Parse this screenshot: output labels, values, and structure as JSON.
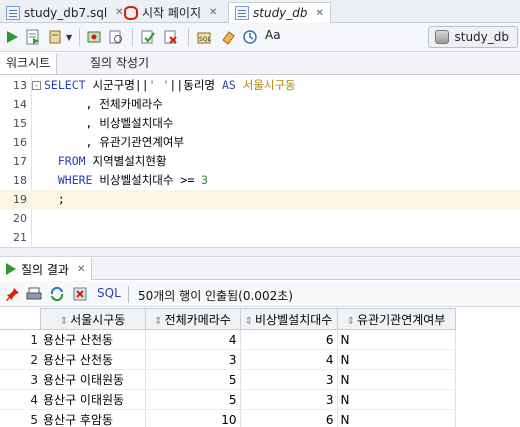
{
  "tabs": [
    {
      "label": "study_db7.sql",
      "icon": "sql-file-icon",
      "active": false
    },
    {
      "label": "시작 페이지",
      "icon": "oracle-logo-icon",
      "active": false
    },
    {
      "label": "study_db",
      "icon": "sql-worksheet-icon",
      "active": true
    }
  ],
  "toolbar": {
    "connection_label": "study_db"
  },
  "subtabs": {
    "worksheet": "워크시트",
    "query_builder": "질의 작성기"
  },
  "editor": {
    "lines": [
      {
        "n": "13",
        "fold": "-",
        "segs": [
          [
            "kw",
            "SELECT "
          ],
          [
            "",
            "시군구명||"
          ],
          [
            "str",
            "' '"
          ],
          [
            "",
            "||동리명 "
          ],
          [
            "kw",
            "AS "
          ],
          [
            "alias",
            "서울시구동"
          ]
        ]
      },
      {
        "n": "14",
        "segs": [
          [
            "",
            "      , 전체카메라수"
          ]
        ]
      },
      {
        "n": "15",
        "segs": [
          [
            "",
            "      , 비상벨설치대수"
          ]
        ]
      },
      {
        "n": "16",
        "segs": [
          [
            "",
            "      , 유관기관연계여부"
          ]
        ]
      },
      {
        "n": "17",
        "segs": [
          [
            "",
            "  "
          ],
          [
            "kw",
            "FROM "
          ],
          [
            "",
            "지역별설치현황"
          ]
        ]
      },
      {
        "n": "18",
        "segs": [
          [
            "",
            "  "
          ],
          [
            "kw",
            "WHERE "
          ],
          [
            "",
            "비상벨설치대수 >= "
          ],
          [
            "num3",
            "3"
          ]
        ]
      },
      {
        "n": "19",
        "segs": [
          [
            "",
            "  ;"
          ]
        ],
        "highlight": true
      },
      {
        "n": "20",
        "segs": []
      },
      {
        "n": "21",
        "segs": []
      }
    ]
  },
  "results": {
    "tab_label": "질의 결과",
    "sql_label": "SQL",
    "message": "50개의 행이 인출됨(0.002초)",
    "columns": [
      "서울시구동",
      "전체카메라수",
      "비상벨설치대수",
      "유관기관연계여부"
    ],
    "rows": [
      {
        "rn": "1",
        "c1": "용산구 산천동",
        "c2": "4",
        "c3": "6",
        "c4": "N"
      },
      {
        "rn": "2",
        "c1": "용산구 산천동",
        "c2": "3",
        "c3": "4",
        "c4": "N"
      },
      {
        "rn": "3",
        "c1": "용산구 이태원동",
        "c2": "5",
        "c3": "3",
        "c4": "N"
      },
      {
        "rn": "4",
        "c1": "용산구 이태원동",
        "c2": "5",
        "c3": "3",
        "c4": "N"
      },
      {
        "rn": "5",
        "c1": "용산구 후암동",
        "c2": "10",
        "c3": "6",
        "c4": "N"
      }
    ]
  },
  "colors": {
    "keyword": "#2a3fb4",
    "string": "#2f8a2f",
    "alias": "#b8860b",
    "run_green": "#2c9a2c",
    "oracle_red": "#d81e05"
  }
}
